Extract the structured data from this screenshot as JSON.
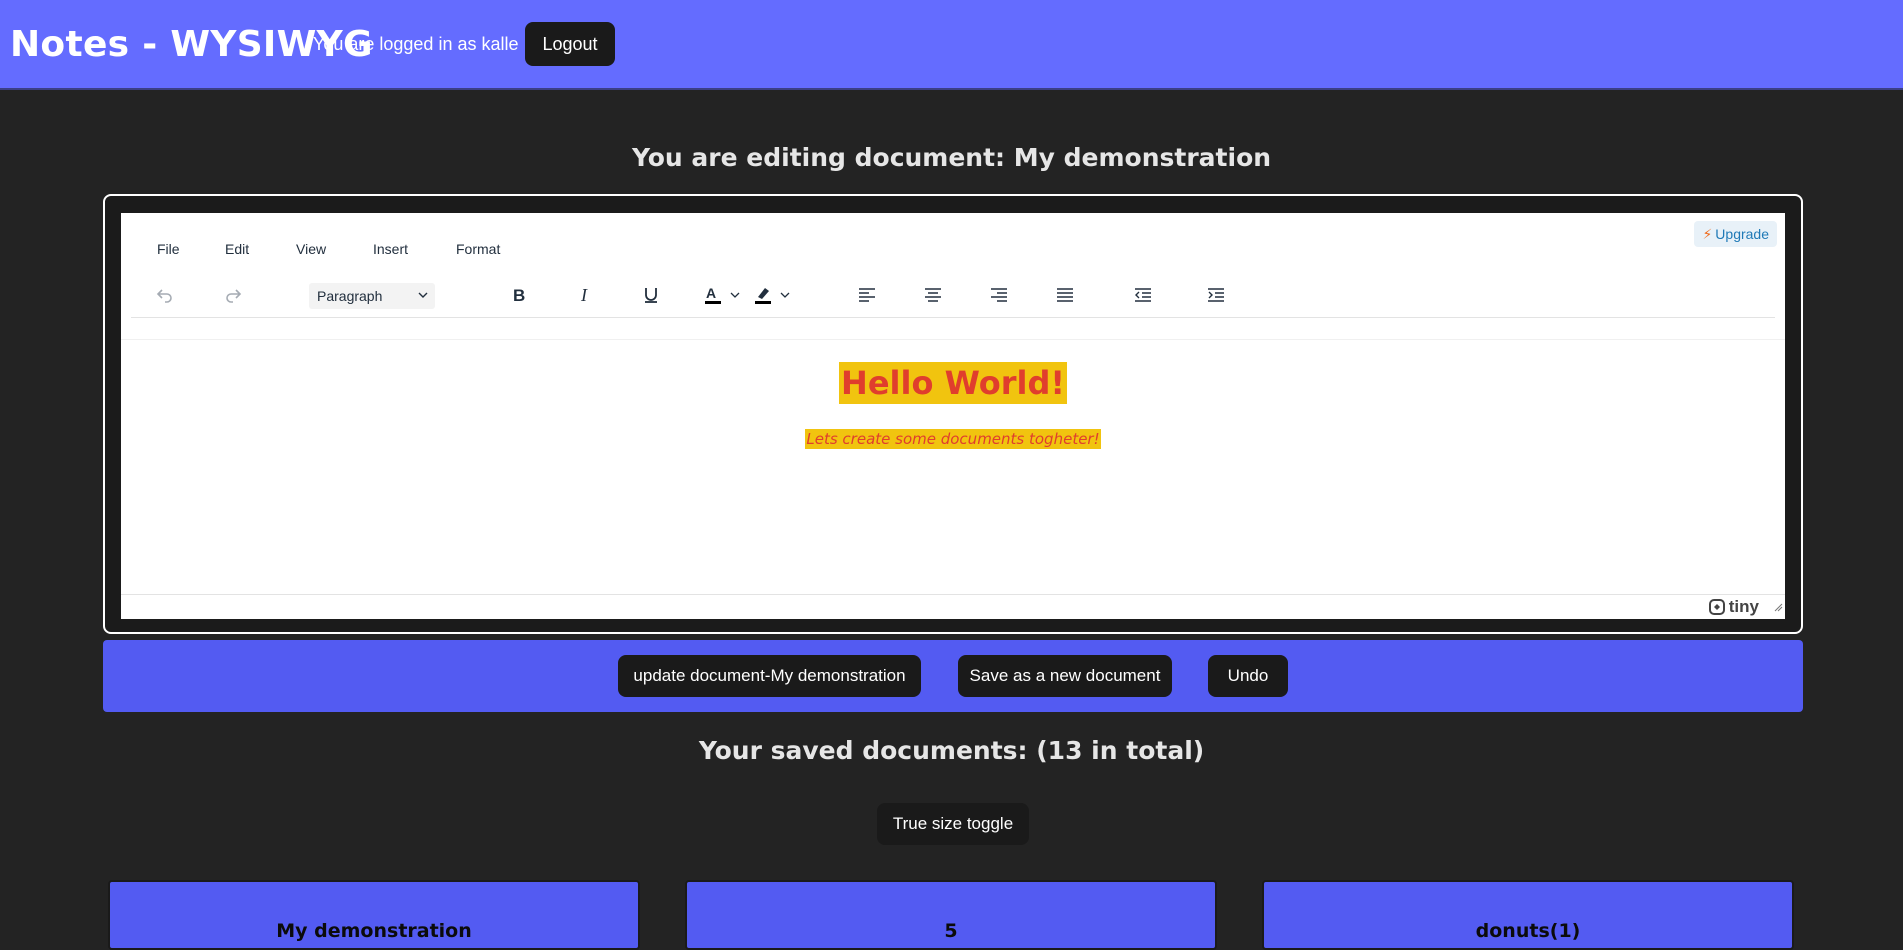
{
  "header": {
    "title": "Notes - WYSIWYG",
    "logged_in_text": "You are logged in as kalle",
    "logout_label": "Logout"
  },
  "editing": {
    "heading": "You are editing document: My demonstration"
  },
  "editor": {
    "menu": [
      "File",
      "Edit",
      "View",
      "Insert",
      "Format"
    ],
    "upgrade_label": "Upgrade",
    "block_format": "Paragraph",
    "toolbar_icons": [
      "undo-icon",
      "redo-icon",
      "bold-icon",
      "italic-icon",
      "underline-icon",
      "text-color-icon",
      "highlight-color-icon",
      "align-left-icon",
      "align-center-icon",
      "align-right-icon",
      "justify-icon",
      "outdent-icon",
      "indent-icon"
    ],
    "content": {
      "heading": "Hello World!",
      "paragraph": "Lets create some documents togheter!"
    },
    "highlight_color": "#f1c40f",
    "text_color": "#e03e2d",
    "brand": "tiny"
  },
  "actions": {
    "update_label": "update document-My demonstration",
    "save_new_label": "Save as a new document",
    "undo_label": "Undo"
  },
  "saved": {
    "heading": "Your saved documents: (13 in total)",
    "toggle_label": "True size toggle",
    "documents": [
      {
        "title": "My demonstration"
      },
      {
        "title": "5"
      },
      {
        "title": "donuts(1)"
      }
    ]
  },
  "colors": {
    "header_bg": "#646cff",
    "action_bar_bg": "#535bf2",
    "page_bg": "#232323",
    "button_bg": "#1a1a1a"
  }
}
